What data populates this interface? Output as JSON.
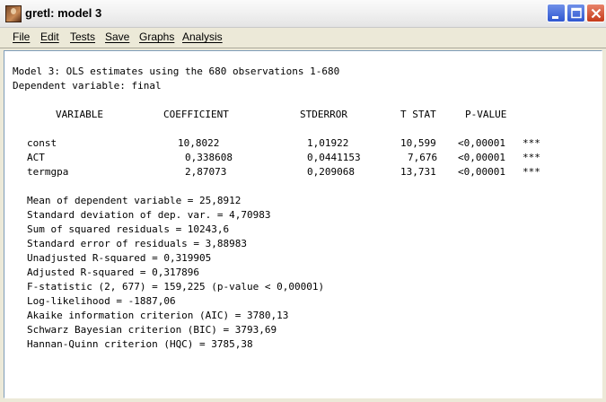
{
  "window": {
    "title": "gretl: model 3"
  },
  "menu": [
    "File",
    "Edit",
    "Tests",
    "Save",
    "Graphs",
    "Analysis"
  ],
  "output": {
    "header1": "Model 3: OLS estimates using the 680 observations 1-680",
    "header2": "Dependent variable: final",
    "columns": {
      "variable": "VARIABLE",
      "coefficient": "COEFFICIENT",
      "stderror": "STDERROR",
      "tstat": "T STAT",
      "pvalue": "P-VALUE"
    },
    "rows": [
      {
        "variable": "const",
        "coefficient": "10,8022",
        "stderror": "1,01922",
        "tstat": "10,599",
        "pvalue": "<0,00001",
        "stars": "***"
      },
      {
        "variable": "ACT",
        "coefficient": "0,338608",
        "stderror": "0,0441153",
        "tstat": "7,676",
        "pvalue": "<0,00001",
        "stars": "***"
      },
      {
        "variable": "termgpa",
        "coefficient": "2,87073",
        "stderror": "0,209068",
        "tstat": "13,731",
        "pvalue": "<0,00001",
        "stars": "***"
      }
    ],
    "stats": [
      "Mean of dependent variable = 25,8912",
      "Standard deviation of dep. var. = 4,70983",
      "Sum of squared residuals = 10243,6",
      "Standard error of residuals = 3,88983",
      "Unadjusted R-squared = 0,319905",
      "Adjusted R-squared = 0,317896",
      "F-statistic (2, 677) = 159,225 (p-value < 0,00001)",
      "Log-likelihood = -1887,06",
      "Akaike information criterion (AIC) = 3780,13",
      "Schwarz Bayesian criterion (BIC) = 3793,69",
      "Hannan-Quinn criterion (HQC) = 3785,38"
    ]
  }
}
